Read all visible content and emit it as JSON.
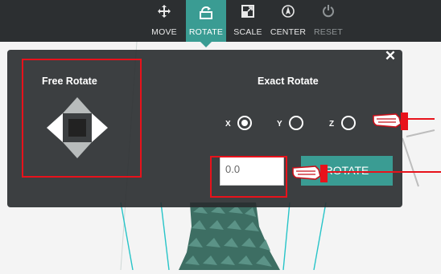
{
  "toolbar": {
    "items": [
      {
        "label": "MOVE",
        "icon": "move-icon",
        "state": "normal"
      },
      {
        "label": "ROTATE",
        "icon": "rotate-icon",
        "state": "active"
      },
      {
        "label": "SCALE",
        "icon": "scale-icon",
        "state": "normal"
      },
      {
        "label": "CENTER",
        "icon": "center-icon",
        "state": "normal"
      },
      {
        "label": "RESET",
        "icon": "reset-icon",
        "state": "disabled"
      }
    ]
  },
  "panel": {
    "close_icon": "close-icon",
    "free_rotate": {
      "title": "Free Rotate"
    },
    "exact_rotate": {
      "title": "Exact Rotate",
      "axes": [
        {
          "label": "X",
          "checked": true
        },
        {
          "label": "Y",
          "checked": false
        },
        {
          "label": "Z",
          "checked": false
        }
      ],
      "value": "0.0",
      "button_label": "ROTATE"
    }
  },
  "colors": {
    "accent": "#3a9c93",
    "toolbar_bg": "#2c2f31",
    "panel_bg": "#2b2e30",
    "highlight": "#e8121b",
    "model": "#3d6e63"
  }
}
